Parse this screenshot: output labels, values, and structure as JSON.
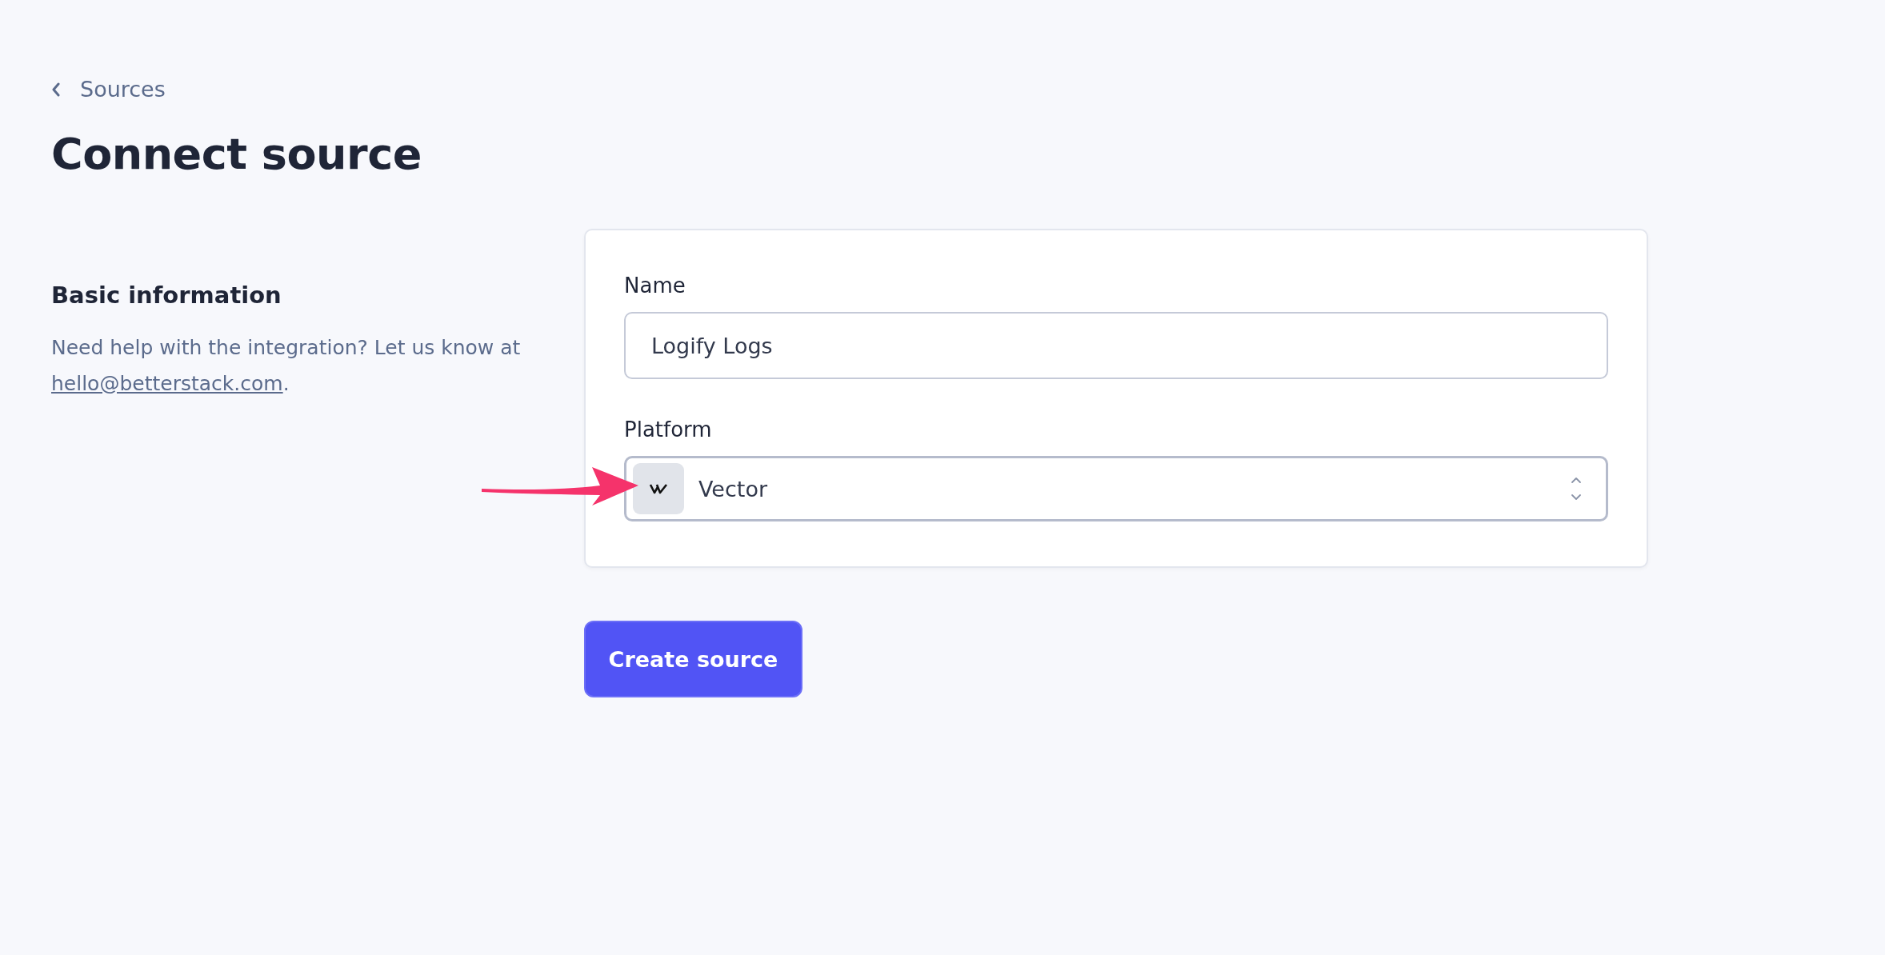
{
  "back_link": {
    "label": "Sources"
  },
  "title": "Connect source",
  "section": {
    "heading": "Basic information",
    "text_before": "Need help with the integration? Let us know at ",
    "email": "hello@betterstack.com",
    "text_after": "."
  },
  "form": {
    "fields": [
      {
        "kind": "text",
        "label": "Name",
        "value": "Logify Logs"
      },
      {
        "kind": "select",
        "label": "Platform",
        "value": "Vector"
      }
    ]
  },
  "submit": {
    "label": "Create source"
  }
}
